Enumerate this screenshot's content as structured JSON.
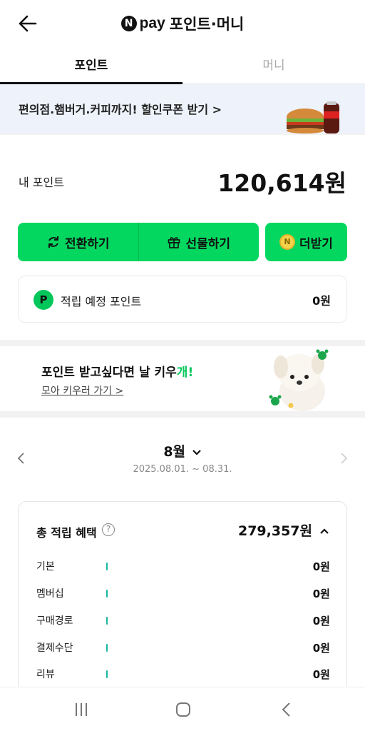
{
  "header": {
    "logo_letter": "N",
    "pay_word": "pay",
    "title": "포인트·머니"
  },
  "tabs": [
    {
      "label": "포인트",
      "active": true
    },
    {
      "label": "머니",
      "active": false
    }
  ],
  "banner": {
    "text": "편의점.햄버거.커피까지! 할인쿠폰 받기 >"
  },
  "my_point": {
    "label": "내 포인트",
    "value": "120,614원"
  },
  "actions": {
    "convert": "전환하기",
    "gift": "선물하기",
    "more": "더받기"
  },
  "scheduled": {
    "badge": "P",
    "label": "적립 예정 포인트",
    "value": "0원"
  },
  "promo": {
    "title_prefix": "포인트 받고싶다면 날 키우",
    "title_accent": "개",
    "title_suffix": "!",
    "link": "모아 키우러 가기 >"
  },
  "period": {
    "month": "8월",
    "range": "2025.08.01. ~ 08.31."
  },
  "summary": {
    "label": "총 적립 혜택",
    "help": "?",
    "total": "279,357원",
    "rows": [
      {
        "label": "기본",
        "value": "0원"
      },
      {
        "label": "멤버십",
        "value": "0원"
      },
      {
        "label": "구매경로",
        "value": "0원"
      },
      {
        "label": "결제수단",
        "value": "0원"
      },
      {
        "label": "리뷰",
        "value": "0원"
      }
    ]
  },
  "colors": {
    "brand_green": "#03d75f",
    "banner_bg": "#eef3fb",
    "bar_teal": "#17b7a1"
  }
}
